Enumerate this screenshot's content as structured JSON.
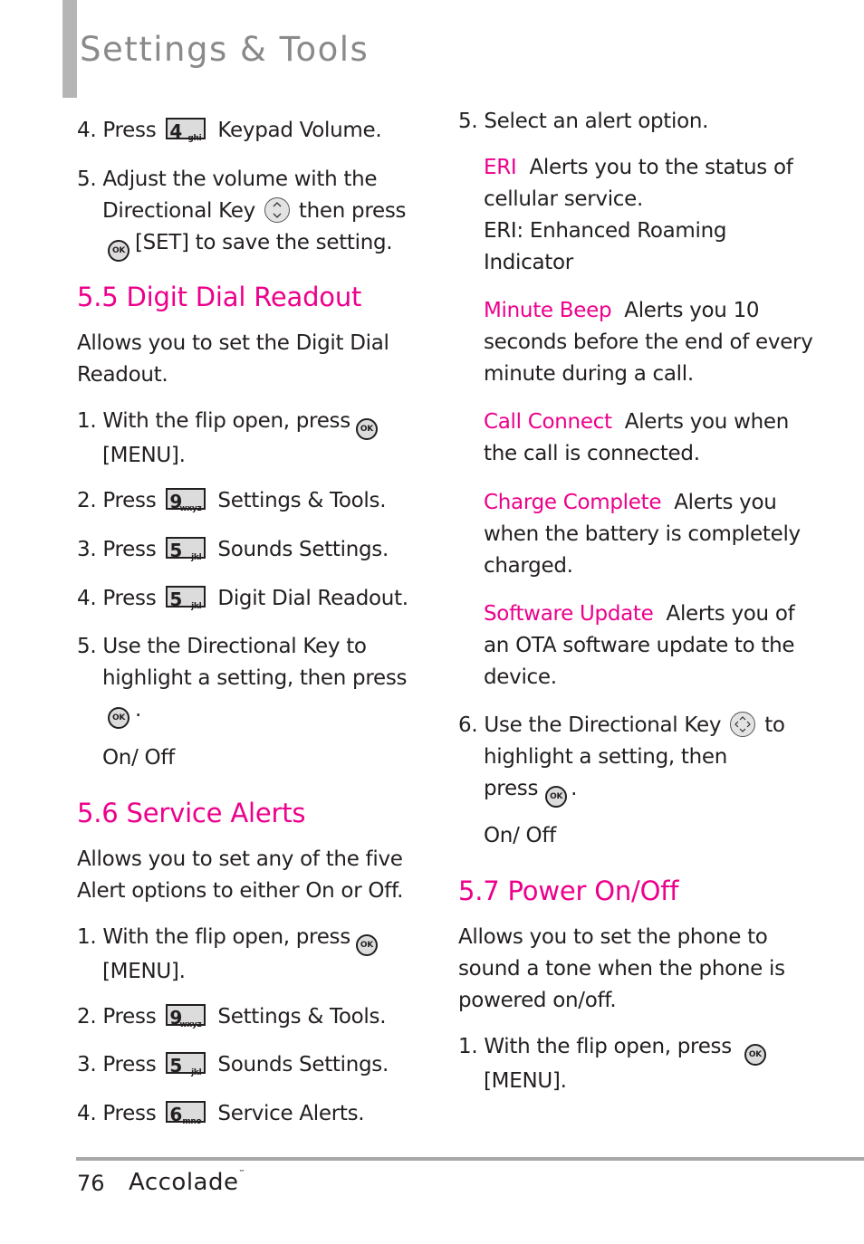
{
  "header": {
    "title": "Settings & Tools"
  },
  "left": {
    "step4_keypad": {
      "num": "4. Press",
      "key_digit": "4",
      "key_letters": "ghi",
      "target": "Keypad Volume",
      "end": "."
    },
    "step5_adjust": {
      "num": "5.",
      "line1": "Adjust the volume with the",
      "line2a": "Directional Key",
      "line2b": "then press",
      "line3a": "[SET]",
      "line3b": " to save the setting."
    },
    "sec55": {
      "heading": "5.5 Digit Dial Readout",
      "intro1": "Allows you to set the Digit Dial",
      "intro2": "Readout.",
      "s1_line1": "1. With the flip open, press",
      "s1_line2": "[MENU]",
      "s2": {
        "num": "2. Press",
        "key_digit": "9",
        "key_letters": "wxyz",
        "target": "Settings & Tools"
      },
      "s3": {
        "num": "3. Press",
        "key_digit": "5",
        "key_letters": "jkl",
        "target": "Sounds Settings"
      },
      "s4": {
        "num": "4. Press",
        "key_digit": "5",
        "key_letters": "jkl",
        "target": "Digit Dial Readout"
      },
      "s5_line1": "5. Use the Directional Key to",
      "s5_line2": "highlight a setting, then press",
      "option": "On/ Off"
    },
    "sec56": {
      "heading": "5.6 Service Alerts",
      "intro1": "Allows you to set any of the five",
      "intro2": "Alert options to either On or Off.",
      "s1_line1": "1. With the flip open, press",
      "s1_line2": "[MENU]",
      "s2": {
        "num": "2. Press",
        "key_digit": "9",
        "key_letters": "wxyz",
        "target": "Settings & Tools"
      },
      "s3": {
        "num": "3. Press",
        "key_digit": "5",
        "key_letters": "jkl",
        "target": "Sounds Settings"
      },
      "s4": {
        "num": "4. Press",
        "key_digit": "6",
        "key_letters": "mno",
        "target": "Service Alerts"
      }
    }
  },
  "right": {
    "s5": "5. Select an alert option.",
    "alerts": [
      {
        "name": "ERI",
        "lines": [
          "Alerts you to the status of",
          "cellular service.",
          "ERI: Enhanced Roaming",
          "Indicator"
        ]
      },
      {
        "name": "Minute Beep",
        "lines": [
          "Alerts you 10",
          "seconds before the end of every",
          "minute during a call."
        ]
      },
      {
        "name": "Call Connect",
        "lines": [
          "Alerts you when",
          "the call is connected."
        ]
      },
      {
        "name": "Charge Complete",
        "lines": [
          "Alerts you",
          "when the battery is completely",
          "charged."
        ]
      },
      {
        "name": "Software Update",
        "lines": [
          "Alerts you of",
          "an OTA software update to the",
          "device."
        ]
      }
    ],
    "s6_line1a": "6. Use the Directional Key",
    "s6_line1b": "to",
    "s6_line2": "highlight a setting, then",
    "s6_line3": "press",
    "option": "On/ Off",
    "sec57": {
      "heading": "5.7 Power On/Off",
      "intro1": "Allows you to set the phone to",
      "intro2": "sound a tone when the phone is",
      "intro3": "powered on/off.",
      "s1_line1": "1. With the flip open, press",
      "s1_line2": "[MENU]"
    }
  },
  "icons": {
    "ok_label": "OK"
  },
  "footer": {
    "page_number": "76",
    "brand": "Accolade",
    "trademark": "™"
  },
  "colors": {
    "accent": "#ec008c",
    "title_gray": "#8a8a8a",
    "rule_gray": "#a8a8a8"
  }
}
